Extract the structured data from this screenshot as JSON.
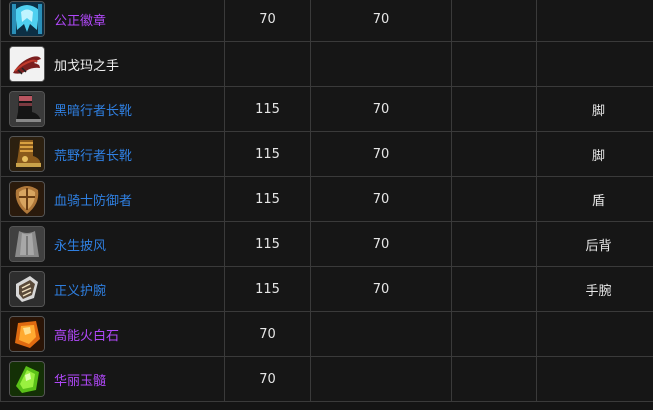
{
  "rows": [
    {
      "icon": "emblem-icon",
      "name": "公正徽章",
      "quality": "epic",
      "item_level": "70",
      "required_level": "70",
      "extra": "",
      "slot": "",
      "color": "#b048f8"
    },
    {
      "icon": "hand-relic-icon",
      "name": "加戈玛之手",
      "quality": "common",
      "item_level": "",
      "required_level": "",
      "extra": "",
      "slot": "",
      "color": "#f0f0f0"
    },
    {
      "icon": "boots-icon",
      "name": "黑暗行者长靴",
      "quality": "rare",
      "item_level": "115",
      "required_level": "70",
      "extra": "",
      "slot": "脚",
      "color": "#2f7fe0"
    },
    {
      "icon": "wild-boots-icon",
      "name": "荒野行者长靴",
      "quality": "rare",
      "item_level": "115",
      "required_level": "70",
      "extra": "",
      "slot": "脚",
      "color": "#2f7fe0"
    },
    {
      "icon": "shield-icon",
      "name": "血骑士防御者",
      "quality": "rare",
      "item_level": "115",
      "required_level": "70",
      "extra": "",
      "slot": "盾",
      "color": "#2f7fe0"
    },
    {
      "icon": "cloak-icon",
      "name": "永生披风",
      "quality": "rare",
      "item_level": "115",
      "required_level": "70",
      "extra": "",
      "slot": "后背",
      "color": "#2f7fe0"
    },
    {
      "icon": "bracer-icon",
      "name": "正义护腕",
      "quality": "rare",
      "item_level": "115",
      "required_level": "70",
      "extra": "",
      "slot": "手腕",
      "color": "#2f7fe0"
    },
    {
      "icon": "orange-gem-icon",
      "name": "高能火白石",
      "quality": "epic",
      "item_level": "70",
      "required_level": "",
      "extra": "",
      "slot": "",
      "color": "#b048f8"
    },
    {
      "icon": "green-gem-icon",
      "name": "华丽玉髓",
      "quality": "epic",
      "item_level": "70",
      "required_level": "",
      "extra": "",
      "slot": "",
      "color": "#b048f8"
    }
  ]
}
